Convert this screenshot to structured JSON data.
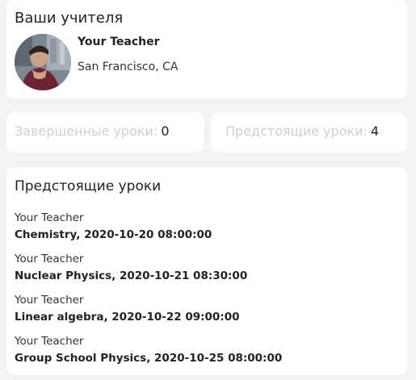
{
  "teachers_section": {
    "title": "Ваши учителя",
    "teacher": {
      "name": "Your Teacher",
      "location": "San Francisco, CA"
    }
  },
  "stats": {
    "completed": {
      "label": "Завершенные уроки:",
      "value": "0"
    },
    "upcoming": {
      "label": "Предстоящие уроки:",
      "value": "4"
    }
  },
  "upcoming_lessons": {
    "title": "Предстоящие уроки",
    "items": [
      {
        "teacher": "Your Teacher",
        "detail": "Chemistry, 2020-10-20 08:00:00"
      },
      {
        "teacher": "Your Teacher",
        "detail": "Nuclear Physics, 2020-10-21 08:30:00"
      },
      {
        "teacher": "Your Teacher",
        "detail": "Linear algebra, 2020-10-22 09:00:00"
      },
      {
        "teacher": "Your Teacher",
        "detail": "Group School Physics, 2020-10-25 08:00:00"
      }
    ]
  }
}
